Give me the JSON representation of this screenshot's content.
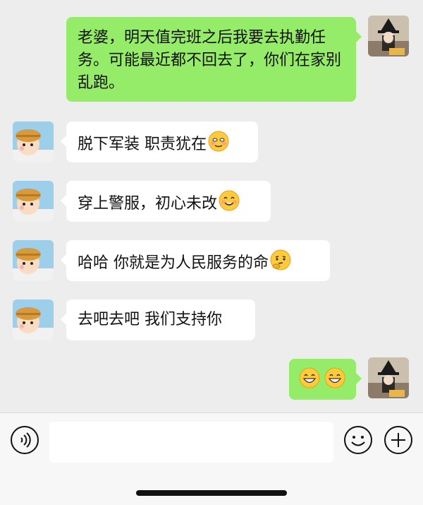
{
  "messages": [
    {
      "id": "m1",
      "side": "out",
      "text": "老婆，明天值完班之后我要去执勤任务。可能最近都不回去了，你们在家别乱跑。"
    },
    {
      "id": "m2",
      "side": "in",
      "text": "脱下军装 职责犹在",
      "emoji": "smile-blush-emoji"
    },
    {
      "id": "m3",
      "side": "in",
      "text": "穿上警服，初心未改",
      "emoji": "smile-emoji"
    },
    {
      "id": "m4",
      "side": "in",
      "text": "哈哈 你就是为人民服务的命",
      "emoji": "thinking-emoji"
    },
    {
      "id": "m5",
      "side": "in",
      "text": "去吧去吧 我们支持你"
    },
    {
      "id": "m6",
      "side": "out",
      "text": "",
      "emoji": "grin-emoji x2"
    }
  ],
  "icons": {
    "voice": "voice-icon",
    "emoji": "emoji-icon",
    "plus": "plus-icon"
  },
  "colors": {
    "outgoing_bubble": "#95ec69",
    "incoming_bubble": "#ffffff",
    "background": "#ededed"
  }
}
